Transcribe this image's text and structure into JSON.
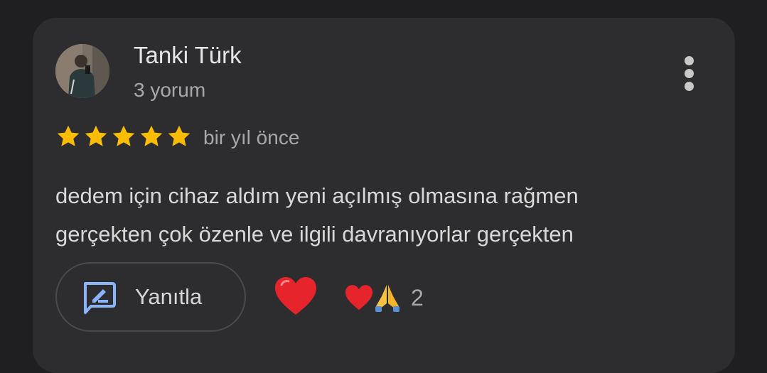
{
  "review": {
    "reviewer_name": "Tanki Türk",
    "review_count": "3 yorum",
    "rating": 5,
    "time": "bir yıl önce",
    "text_lines": [
      "dedem için cihaz aldım yeni açılmış olmasına rağmen",
      "gerçekten çok özenle ve ilgili davranıyorlar gerçekten"
    ]
  },
  "actions": {
    "reply_label": "Yanıtla",
    "reaction_count": "2"
  },
  "icons": {
    "avatar": "avatar-photo",
    "menu": "more-vert-icon",
    "star": "star-icon",
    "reply": "reply-edit-icon",
    "react": "heart-icon",
    "reactions": [
      "heart-icon",
      "folded-hands-icon"
    ]
  },
  "colors": {
    "background": "#1f1f21",
    "card": "#2d2d2f",
    "star": "#fbbc04",
    "reply_icon": "#8ab4f8",
    "heart": "#e5252b"
  }
}
